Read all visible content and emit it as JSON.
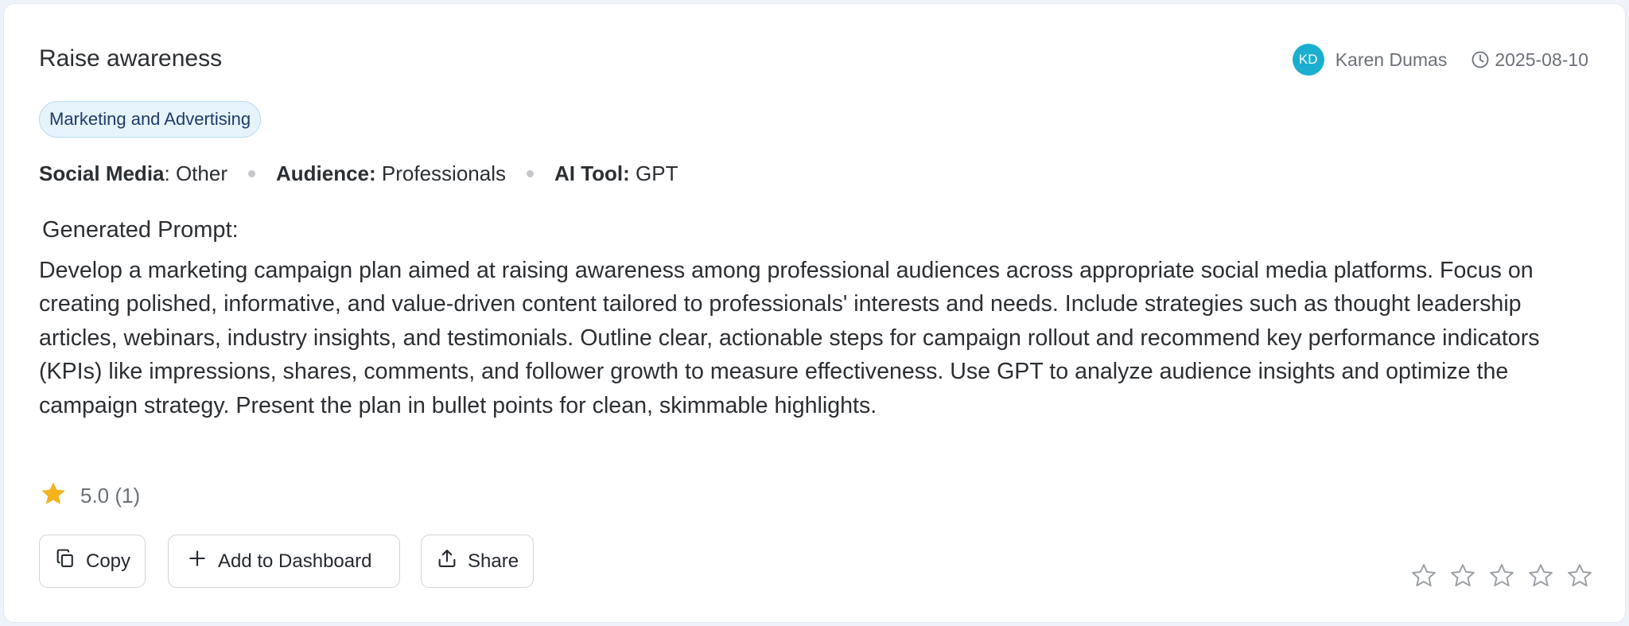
{
  "prompt_card": {
    "title": "Raise awareness",
    "author": {
      "initials": "KD",
      "name": "Karen Dumas",
      "avatar_color": "#1aafd0"
    },
    "date": "2025-08-10",
    "category_tag": "Marketing and Advertising",
    "attributes": [
      {
        "label": "Social Media",
        "value": ": Other"
      },
      {
        "label": "Audience:",
        "value": " Professionals"
      },
      {
        "label": "AI Tool:",
        "value": " GPT"
      }
    ],
    "generated_prompt_label": "Generated Prompt:",
    "generated_prompt_text": "Develop a marketing campaign plan aimed at raising awareness among professional audiences across appropriate social media platforms. Focus on creating polished, informative, and value-driven content tailored to professionals' interests and needs. Include strategies such as thought leadership articles, webinars, industry insights, and testimonials. Outline clear, actionable steps for campaign rollout and recommend key performance indicators (KPIs) like impressions, shares, comments, and follower growth to measure effectiveness. Use GPT to analyze audience insights and optimize the campaign strategy. Present the plan in bullet points for clean, skimmable highlights.",
    "rating": {
      "text": "5.0 (1)",
      "average": 5.0,
      "count": 1,
      "star_color": "#f2b31e"
    },
    "actions": {
      "copy_label": "Copy",
      "add_label": "Add to Dashboard",
      "share_label": "Share"
    },
    "user_rating": {
      "max_stars": 5,
      "selected": 0
    },
    "icons": [
      "clock-icon",
      "star-filled-icon",
      "copy-icon",
      "plus-icon",
      "share-upload-icon",
      "star-outline-icon"
    ]
  }
}
